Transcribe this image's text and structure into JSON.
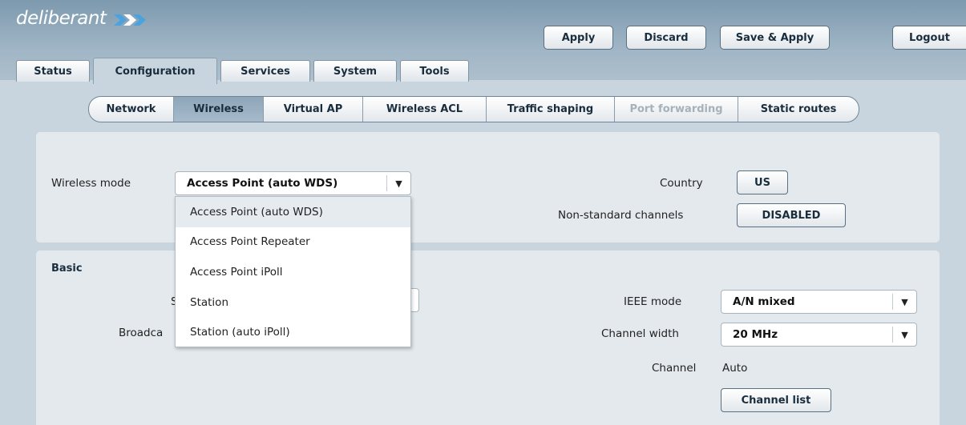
{
  "brand": {
    "logo_text": "deliberant"
  },
  "header_buttons": {
    "apply": "Apply",
    "discard": "Discard",
    "save_apply": "Save & Apply",
    "logout": "Logout"
  },
  "main_tabs": [
    {
      "label": "Status"
    },
    {
      "label": "Configuration",
      "active": true
    },
    {
      "label": "Services"
    },
    {
      "label": "System"
    },
    {
      "label": "Tools"
    }
  ],
  "sub_tabs": [
    {
      "label": "Network"
    },
    {
      "label": "Wireless",
      "active": true
    },
    {
      "label": "Virtual AP"
    },
    {
      "label": "Wireless ACL"
    },
    {
      "label": "Traffic shaping"
    },
    {
      "label": "Port forwarding",
      "disabled": true
    },
    {
      "label": "Static routes"
    }
  ],
  "wireless": {
    "mode_label": "Wireless mode",
    "mode_value": "Access Point (auto WDS)",
    "mode_options": [
      "Access Point (auto WDS)",
      "Access Point Repeater",
      "Access Point iPoll",
      "Station",
      "Station (auto iPoll)"
    ],
    "country_label": "Country",
    "country_value": "US",
    "nonstd_label": "Non-standard channels",
    "nonstd_value": "DISABLED"
  },
  "basic": {
    "section_title": "Basic",
    "partial_label_1": "S",
    "partial_label_2": "Broadca",
    "ieee_label": "IEEE mode",
    "ieee_value": "A/N mixed",
    "width_label": "Channel width",
    "width_value": "20 MHz",
    "channel_label": "Channel",
    "channel_value": "Auto",
    "channel_list_button": "Channel list"
  },
  "colors": {
    "header_bg": "#7d99ae",
    "page_bg": "#c9d5de",
    "panel_bg": "#e3e9ed",
    "active_subtab": "#8ea6b8"
  }
}
